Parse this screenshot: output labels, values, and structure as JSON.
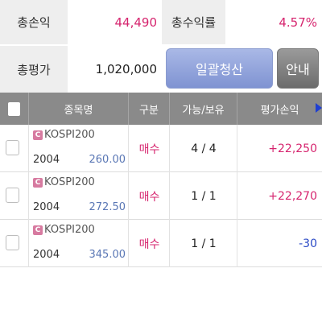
{
  "summary": {
    "total_pl_label": "총손익",
    "total_pl_value": "44,490",
    "total_return_label": "총수익률",
    "total_return_value": "4.57%",
    "total_eval_label": "총평가",
    "total_eval_value": "1,020,000",
    "liquidate_button": "일괄청산",
    "guide_button": "안내"
  },
  "table": {
    "headers": [
      "종목명",
      "구분",
      "가능/보유",
      "평가손익"
    ],
    "rows": [
      {
        "badge": "C",
        "name": "KOSPI200",
        "code": "2004",
        "price": "260.00",
        "side": "매수",
        "qty": "4 / 4",
        "pl": "+22,250"
      },
      {
        "badge": "C",
        "name": "KOSPI200",
        "code": "2004",
        "price": "272.50",
        "side": "매수",
        "qty": "1 / 1",
        "pl": "+22,270"
      },
      {
        "badge": "C",
        "name": "KOSPI200",
        "code": "2004",
        "price": "345.00",
        "side": "매수",
        "qty": "1 / 1",
        "pl": "-30"
      }
    ]
  },
  "colors": {
    "positive": "#d6246e",
    "negative": "#2a49c6",
    "header_bg": "#8a8a8a",
    "liquidate_bg": "#8a9bd6",
    "guide_bg": "#777777"
  },
  "icons": {
    "more_columns": "arrow-right-icon",
    "call_badge": "call-option-badge-icon",
    "checkbox": "checkbox-icon"
  }
}
